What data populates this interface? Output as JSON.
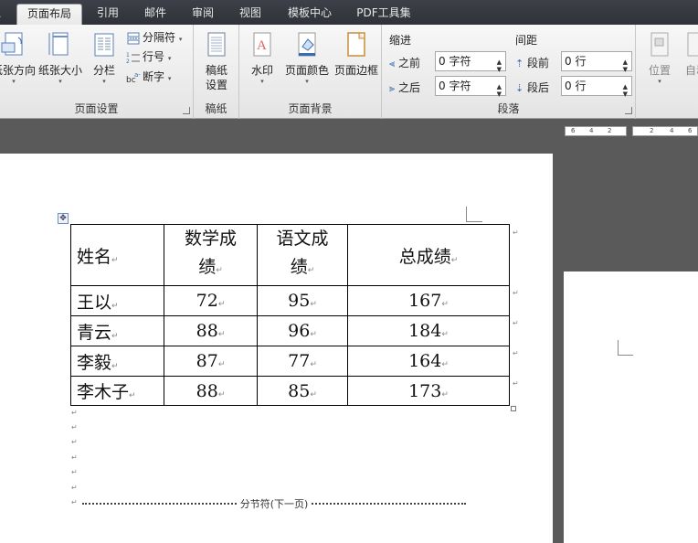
{
  "tabs": [
    {
      "label": "页面布局",
      "active": true
    },
    {
      "label": "引用"
    },
    {
      "label": "邮件"
    },
    {
      "label": "审阅"
    },
    {
      "label": "视图"
    },
    {
      "label": "模板中心"
    },
    {
      "label": "PDF工具集"
    }
  ],
  "ribbon": {
    "page_setup": {
      "label": "页面设置",
      "orientation": "纸张方向",
      "size": "纸张大小",
      "columns": "分栏",
      "breaks": "分隔符",
      "line_numbers": "行号",
      "hyphenation": "断字"
    },
    "draft": {
      "label": "稿纸",
      "button_line1": "稿纸",
      "button_line2": "设置"
    },
    "page_background": {
      "label": "页面背景",
      "watermark": "水印",
      "page_color": "页面颜色",
      "page_borders": "页面边框"
    },
    "paragraph": {
      "label": "段落",
      "indent_title": "缩进",
      "spacing_title": "间距",
      "indent_before_label": "之前",
      "indent_before_value": "0 字符",
      "indent_after_label": "之后",
      "indent_after_value": "0 字符",
      "space_before_label": "段前",
      "space_before_value": "0 行",
      "space_after_label": "段后",
      "space_after_value": "0 行"
    },
    "arrange": {
      "position": "位置",
      "wrap": "自动"
    }
  },
  "ruler": {
    "left_ticks": [
      "6",
      "4",
      "2"
    ],
    "right_ticks": [
      "2",
      "4",
      "6"
    ]
  },
  "table": {
    "headers": [
      {
        "line1": "姓名"
      },
      {
        "line1": "数学成",
        "line2": "绩"
      },
      {
        "line1": "语文成",
        "line2": "绩"
      },
      {
        "line1": "总成绩"
      }
    ],
    "rows": [
      [
        "王以",
        "72",
        "95",
        "167"
      ],
      [
        "青云",
        "88",
        "96",
        "184"
      ],
      [
        "李毅",
        "87",
        "77",
        "164"
      ],
      [
        "李木子",
        "88",
        "85",
        "173"
      ]
    ]
  },
  "section_break": "分节符(下一页)",
  "colors": {
    "tabbar": "#33363c",
    "ribbon": "#ededed",
    "workspace": "#5a5a5a",
    "page": "#ffffff",
    "watermark_red": "#d04040"
  }
}
